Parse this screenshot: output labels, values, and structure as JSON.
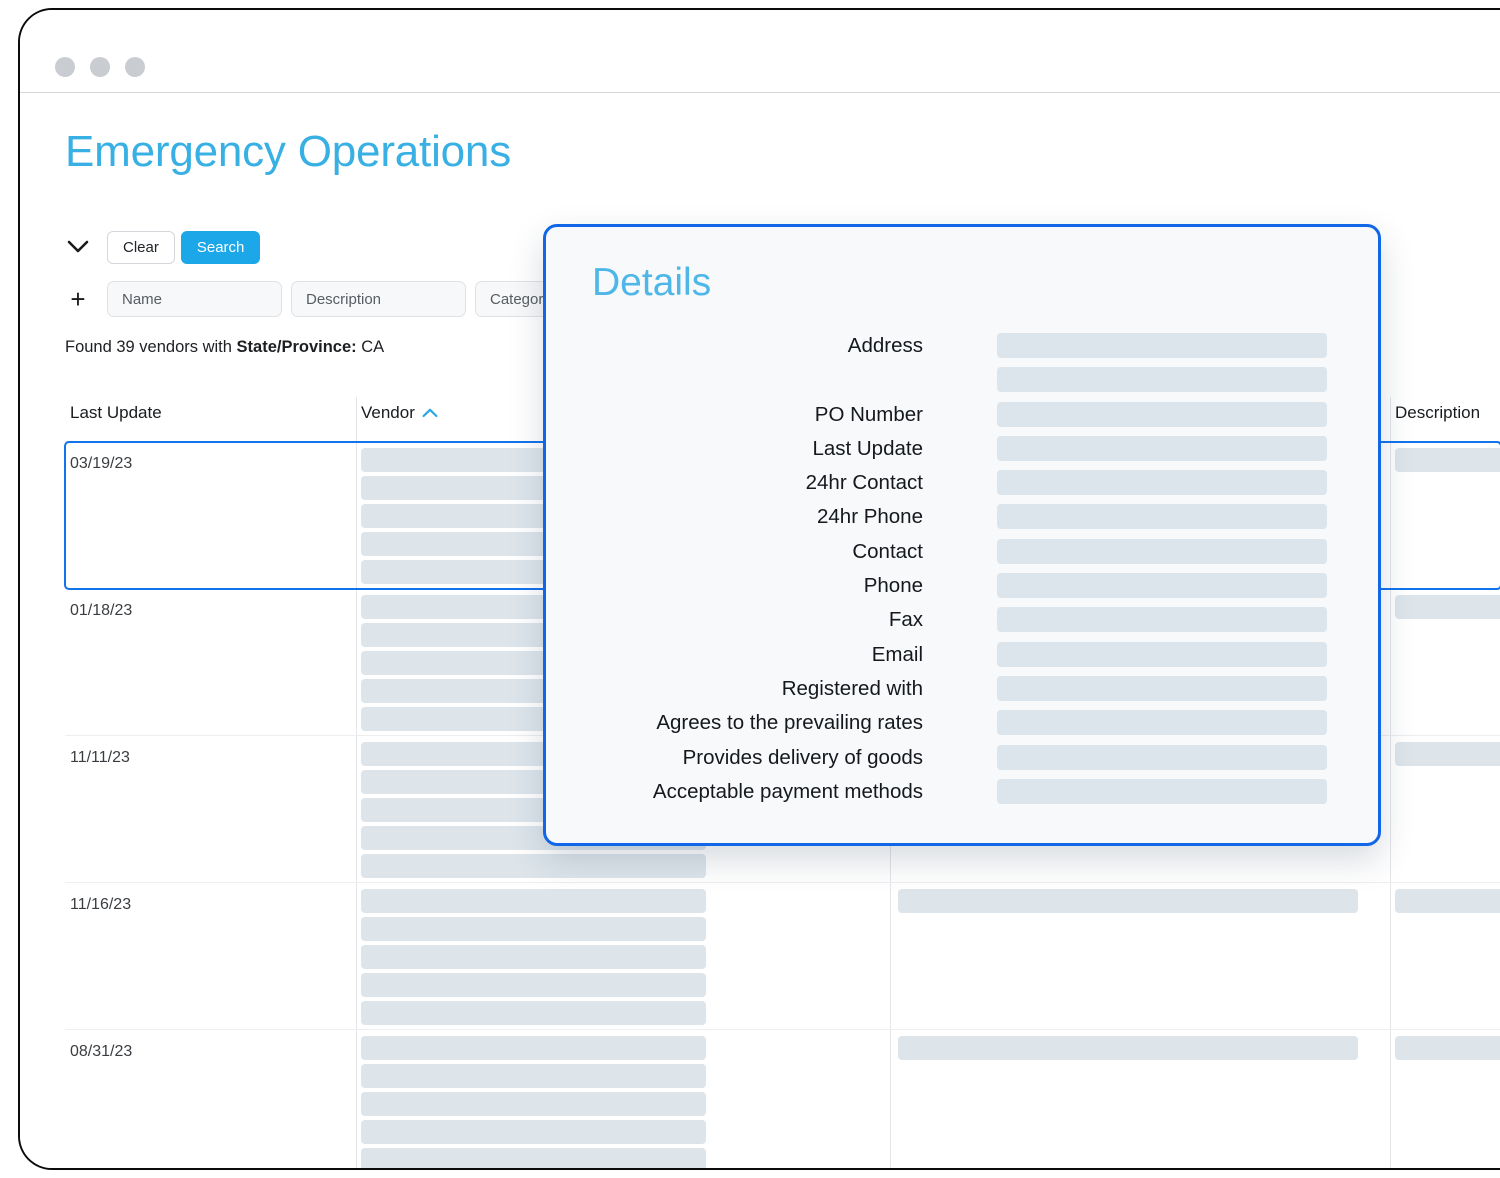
{
  "window": {
    "traffic_lights": [
      "close-dot",
      "minimize-dot",
      "maximize-dot"
    ]
  },
  "header": {
    "title": "Emergency Operations"
  },
  "toolbar": {
    "collapse_icon": "chevron-down-icon",
    "add_filter_icon": "plus-icon",
    "clear_label": "Clear",
    "search_label": "Search"
  },
  "filters": [
    {
      "placeholder": "Name"
    },
    {
      "placeholder": "Description"
    },
    {
      "placeholder": "Category"
    }
  ],
  "results": {
    "prefix": "Found 39 vendors with ",
    "facet_label": "State/Province:",
    "facet_value": " CA",
    "count": 39
  },
  "table": {
    "columns": [
      {
        "label": "Last Update",
        "sort": ""
      },
      {
        "label": "Vendor",
        "sort": "sort-asc-icon"
      },
      {
        "label": "Description",
        "sort": ""
      }
    ],
    "rows": [
      {
        "date": "03/19/23",
        "selected": true
      },
      {
        "date": "01/18/23",
        "selected": false
      },
      {
        "date": "11/11/23",
        "selected": false
      },
      {
        "date": "11/16/23",
        "selected": false
      },
      {
        "date": "08/31/23",
        "selected": false
      }
    ]
  },
  "details": {
    "title": "Details",
    "fields": [
      {
        "label": "Address"
      },
      {
        "label": ""
      },
      {
        "label": "PO Number"
      },
      {
        "label": "Last Update"
      },
      {
        "label": "24hr Contact"
      },
      {
        "label": "24hr Phone"
      },
      {
        "label": "Contact"
      },
      {
        "label": "Phone"
      },
      {
        "label": "Fax"
      },
      {
        "label": "Email"
      },
      {
        "label": "Registered with"
      },
      {
        "label": "Agrees to the prevailing rates"
      },
      {
        "label": "Provides delivery of goods"
      },
      {
        "label": "Acceptable payment methods"
      }
    ]
  },
  "colors": {
    "brand_light_blue": "#38b0e3",
    "accent_blue": "#1ca7e8",
    "selection_blue": "#1273eb",
    "panel_border_blue": "#1266e8",
    "skeleton": "#dde5ec",
    "panel_bg": "#f7f9fb"
  }
}
